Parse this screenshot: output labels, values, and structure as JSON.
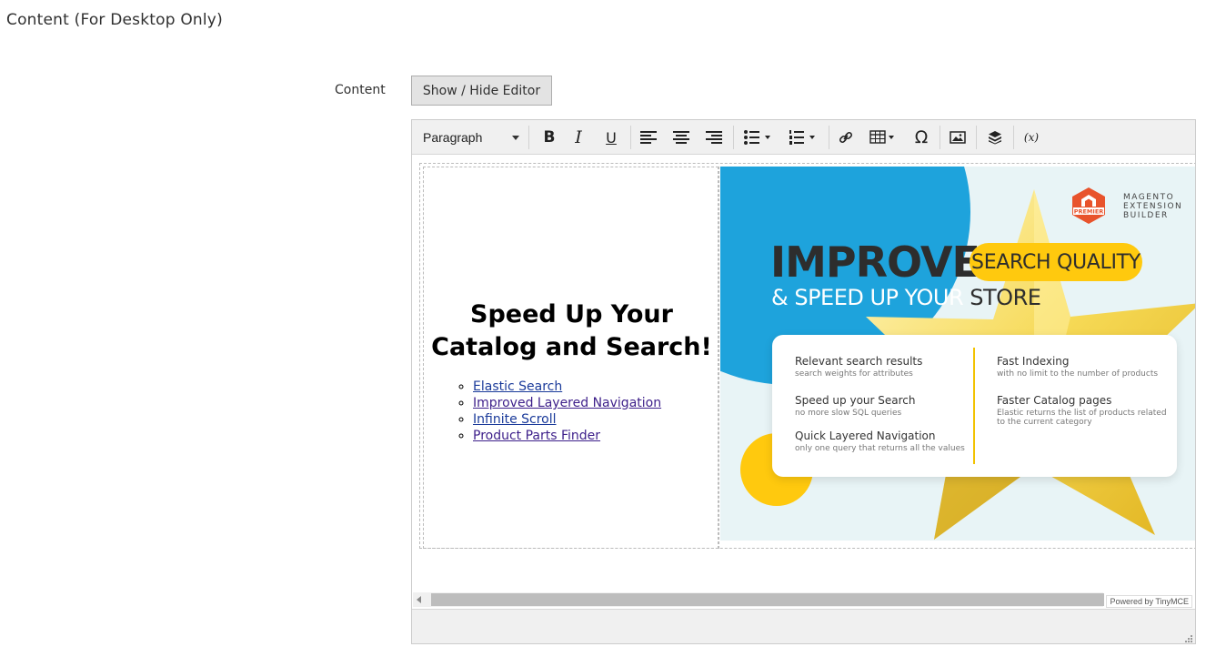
{
  "section": {
    "title": "Content (For Desktop Only)"
  },
  "field": {
    "label": "Content",
    "toggle_label": "Show / Hide Editor"
  },
  "toolbar": {
    "format_select": "Paragraph",
    "buttons": [
      {
        "name": "bold",
        "icon": "bold-icon",
        "glyph": "B"
      },
      {
        "name": "italic",
        "icon": "italic-icon",
        "glyph": "I"
      },
      {
        "name": "underline",
        "icon": "underline-icon",
        "glyph": "U"
      },
      {
        "name": "align-left",
        "icon": "align-left-icon"
      },
      {
        "name": "align-center",
        "icon": "align-center-icon"
      },
      {
        "name": "align-right",
        "icon": "align-right-icon"
      },
      {
        "name": "bullet-list",
        "icon": "bullet-list-icon"
      },
      {
        "name": "numbered-list",
        "icon": "numbered-list-icon"
      },
      {
        "name": "link",
        "icon": "link-icon"
      },
      {
        "name": "table",
        "icon": "table-icon"
      },
      {
        "name": "special-character",
        "icon": "omega-icon",
        "glyph": "Ω"
      },
      {
        "name": "insert-image",
        "icon": "image-icon"
      },
      {
        "name": "insert-widget",
        "icon": "widget-icon"
      },
      {
        "name": "insert-variable",
        "icon": "variable-icon",
        "glyph": "(x)"
      }
    ]
  },
  "content": {
    "headline": "Speed Up Your Catalog and Search!",
    "links": [
      "Elastic Search",
      "Improved Layered Navigation",
      "Infinite Scroll",
      "Product Parts Finder"
    ]
  },
  "banner": {
    "logo_text": [
      "MAGENTO",
      "EXTENSION",
      "BUILDER"
    ],
    "logo_badge": "PREMIER",
    "headline_word": "IMPROVE",
    "pill_text": "SEARCH QUALITY",
    "subline_prefix": "& SPEED UP YOUR",
    "subline_store": "STORE",
    "features": [
      {
        "title": "Relevant search results",
        "subtitle": "search weights for attributes"
      },
      {
        "title": "Speed up your Search",
        "subtitle": "no more slow SQL queries"
      },
      {
        "title": "Quick Layered Navigation",
        "subtitle": "only one query that returns all the values"
      },
      {
        "title": "Fast Indexing",
        "subtitle": "with no limit to the number of products"
      },
      {
        "title": "Faster Catalog pages",
        "subtitle": "Elastic returns the list of products related to the current category"
      }
    ],
    "colors": {
      "blue": "#1ea3dc",
      "yellow": "#ffc90e",
      "dark": "#2d2d2d",
      "orange": "#e8532c"
    }
  },
  "footer": {
    "powered_by": "Powered by TinyMCE"
  }
}
